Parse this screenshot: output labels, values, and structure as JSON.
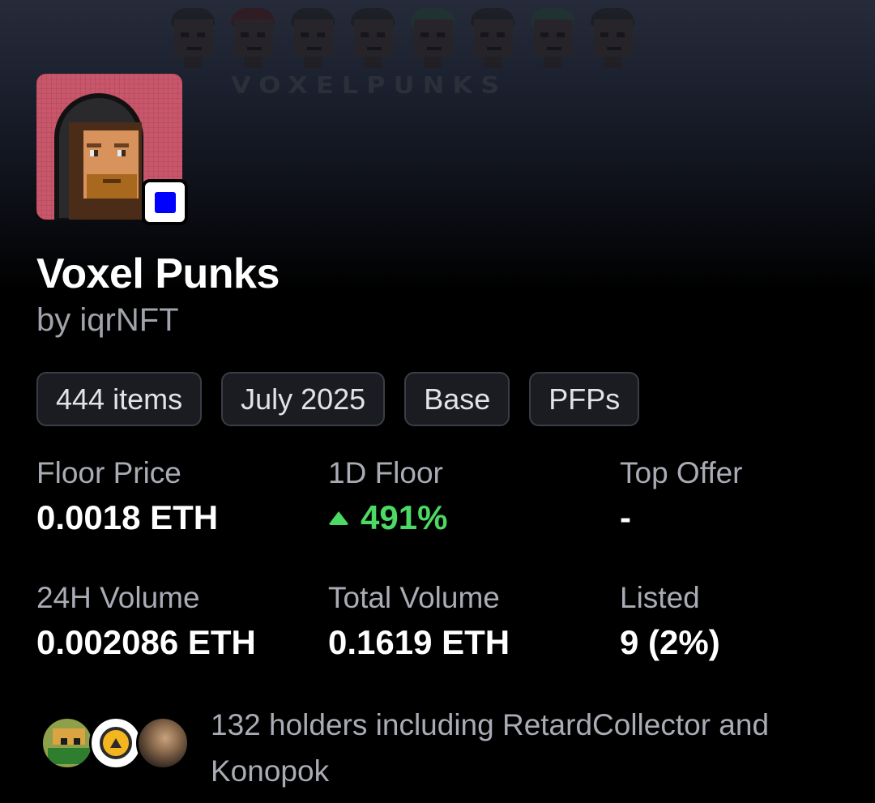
{
  "banner": {
    "wordmark": "VOXELPUNKS"
  },
  "collection": {
    "name": "Voxel Punks",
    "creator": "by iqrNFT",
    "chain_badge_color": "#0000ff"
  },
  "chips": [
    {
      "label": "444 items"
    },
    {
      "label": "July 2025"
    },
    {
      "label": "Base"
    },
    {
      "label": "PFPs"
    }
  ],
  "stats": {
    "floor_price": {
      "label": "Floor Price",
      "value": "0.0018 ETH"
    },
    "one_day_floor": {
      "label": "1D Floor",
      "value": "491%",
      "direction": "up",
      "color": "#4cd964"
    },
    "top_offer": {
      "label": "Top Offer",
      "value": "-"
    },
    "volume_24h": {
      "label": "24H Volume",
      "value": "0.002086 ETH"
    },
    "total_volume": {
      "label": "Total Volume",
      "value": "0.1619 ETH"
    },
    "listed": {
      "label": "Listed",
      "value": "9 (2%)"
    }
  },
  "holders": {
    "text": "132 holders including RetardCollector and Konopok",
    "avatars": [
      "pixel-frog-avatar",
      "gold-coin-avatar",
      "painting-avatar"
    ]
  }
}
